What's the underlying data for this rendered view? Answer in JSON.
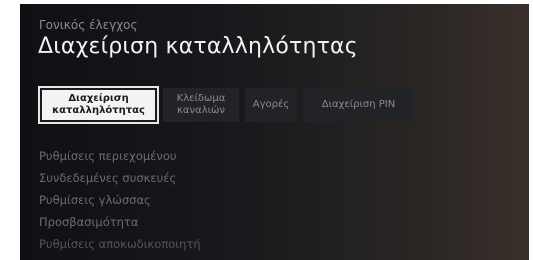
{
  "header": {
    "breadcrumb": "Γονικός έλεγχος",
    "title": "Διαχείριση καταλληλότητας"
  },
  "tabs": [
    {
      "label": "Διαχείριση\nκαταλληλότητας",
      "selected": true
    },
    {
      "label": "Κλείδωμα\nκαναλιών",
      "selected": false
    },
    {
      "label": "Αγορές",
      "selected": false
    },
    {
      "label": "Διαχείριση PIN",
      "selected": false
    }
  ],
  "settings": {
    "items": [
      {
        "label": "Ρυθμίσεις περιεχομένου"
      },
      {
        "label": "Συνδεδεμένες συσκευές"
      },
      {
        "label": "Ρυθμίσεις γλώσσας"
      },
      {
        "label": "Προσβασιμότητα"
      },
      {
        "label": "Ρυθμίσεις αποκωδικοποιητή"
      }
    ]
  },
  "colors": {
    "background": "#15171b",
    "selected_tab_bg": "#f3f3f3",
    "tab_bg": "#222326",
    "title_text": "#f2f2f2"
  }
}
